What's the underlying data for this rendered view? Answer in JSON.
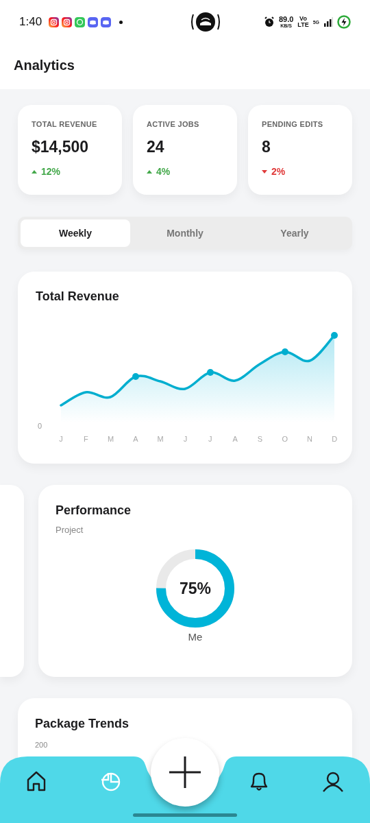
{
  "status_bar": {
    "time": "1:40",
    "network_speed": "89.0",
    "speed_unit": "KB/S",
    "volte_top": "Vo",
    "volte_bottom": "LTE",
    "network_type": "5G"
  },
  "header": {
    "title": "Analytics"
  },
  "stats": [
    {
      "label": "TOTAL REVENUE",
      "value": "$14,500",
      "change": "12%",
      "kind": "up"
    },
    {
      "label": "ACTIVE JOBS",
      "value": "24",
      "change": "4%",
      "kind": "up"
    },
    {
      "label": "PENDING EDITS",
      "value": "8",
      "change": "2%",
      "kind": "down"
    }
  ],
  "period_tabs": [
    {
      "label": "Weekly",
      "selected": true
    },
    {
      "label": "Monthly",
      "selected": false
    },
    {
      "label": "Yearly",
      "selected": false
    }
  ],
  "revenue_chart": {
    "title": "Total Revenue",
    "y_label": "0",
    "x_labels": [
      "J",
      "F",
      "M",
      "A",
      "M",
      "J",
      "J",
      "A",
      "S",
      "O",
      "N",
      "D"
    ]
  },
  "performance": {
    "title": "Performance",
    "subtitle": "Project",
    "level": 0.75,
    "reading": "75%",
    "caption": "Me"
  },
  "package_trends": {
    "title": "Package Trends",
    "y_label": "200"
  },
  "bottom_nav": [
    {
      "kind": "home",
      "selected": false
    },
    {
      "kind": "chart",
      "selected": true
    },
    {
      "kind": "add"
    },
    {
      "kind": "bell",
      "selected": false
    },
    {
      "kind": "user",
      "selected": false
    }
  ]
}
